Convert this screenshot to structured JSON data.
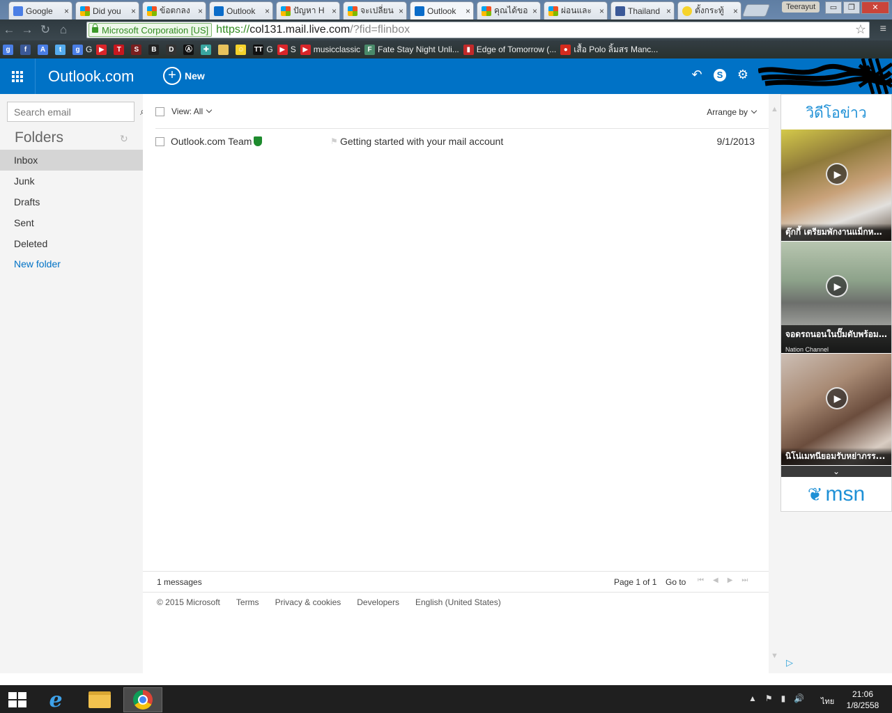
{
  "browser": {
    "tabs": [
      {
        "title": "Google",
        "favicon": "google-translate-icon"
      },
      {
        "title": "Did you",
        "favicon": "microsoft-icon"
      },
      {
        "title": "ข้อตกลง",
        "favicon": "microsoft-icon"
      },
      {
        "title": "Outlook",
        "favicon": "outlook-icon"
      },
      {
        "title": "ปัญหา H",
        "favicon": "microsoft-icon"
      },
      {
        "title": "จะเปลี่ยน",
        "favicon": "microsoft-icon"
      },
      {
        "title": "Outlook",
        "favicon": "outlook-icon"
      },
      {
        "title": "คุณได้ขอ",
        "favicon": "microsoft-icon"
      },
      {
        "title": "ผ่อนและ",
        "favicon": "microsoft-icon"
      },
      {
        "title": "Thailand",
        "favicon": "facebook-icon"
      },
      {
        "title": "ตั้งกระทู้",
        "favicon": "smiley-icon"
      }
    ],
    "tab_close": "×",
    "profile_name": "Teerayut",
    "window_buttons": {
      "minimize": "▭",
      "maximize": "❐",
      "close": "✕"
    },
    "nav": {
      "back": "←",
      "forward": "→",
      "reload": "↻",
      "home": "⌂"
    },
    "ev_cert": "Microsoft Corporation [US]",
    "url_scheme": "https://",
    "url_host": "col131.mail.live.com",
    "url_path": "/?fid=flinbox",
    "bookmark_star": "☆",
    "menu_icon": "≡",
    "bookmarks": [
      {
        "label": "",
        "icon": "google-plus-icon",
        "color": "#4a7ee5",
        "glyph": "g"
      },
      {
        "label": "",
        "icon": "facebook-icon",
        "color": "#3b5998",
        "glyph": "f"
      },
      {
        "label": "",
        "icon": "translate-icon",
        "color": "#4a7ee5",
        "glyph": "A"
      },
      {
        "label": "",
        "icon": "twitter-icon",
        "color": "#55acee",
        "glyph": "t"
      },
      {
        "label": "G",
        "icon": "google-icon",
        "color": "#4a7ee5",
        "glyph": "g"
      },
      {
        "label": "",
        "icon": "youtube-icon",
        "color": "#d9252a",
        "glyph": "▶"
      },
      {
        "label": "",
        "icon": "tc-icon",
        "color": "#c7171e",
        "glyph": "T"
      },
      {
        "label": "",
        "icon": "anime-icon",
        "color": "#7a1f1f",
        "glyph": "S"
      },
      {
        "label": "",
        "icon": "bookmark-b-icon",
        "color": "#222222",
        "glyph": "B"
      },
      {
        "label": "",
        "icon": "bookmark-d-icon",
        "color": "#333333",
        "glyph": "D"
      },
      {
        "label": "",
        "icon": "anarchy-icon",
        "color": "#111111",
        "glyph": "Ⓐ"
      },
      {
        "label": "",
        "icon": "puzzle-icon",
        "color": "#3aa6a0",
        "glyph": "✚"
      },
      {
        "label": "",
        "icon": "folder-icon",
        "color": "#e8c25c",
        "glyph": ""
      },
      {
        "label": "",
        "icon": "smiley-icon",
        "color": "#f6d32b",
        "glyph": "☺"
      },
      {
        "label": "G",
        "icon": "tt-icon",
        "color": "#111111",
        "glyph": "TT"
      },
      {
        "label": "S",
        "icon": "youtube-icon",
        "color": "#d9252a",
        "glyph": "▶"
      },
      {
        "label": "musicclassic",
        "icon": "youtube-icon",
        "color": "#d9252a",
        "glyph": "▶"
      },
      {
        "label": "Fate Stay Night Unli...",
        "icon": "fate-icon",
        "color": "#4a8a6a",
        "glyph": "F"
      },
      {
        "label": "Edge of Tomorrow (...",
        "icon": "popcorn-icon",
        "color": "#c22a2a",
        "glyph": "▮"
      },
      {
        "label": "เสื้อ Polo ลิ้มสร Manc...",
        "icon": "club-crest-icon",
        "color": "#d52b1e",
        "glyph": "●"
      }
    ]
  },
  "outlook": {
    "brand": "Outlook.com",
    "new_label": "New",
    "new_plus": "+",
    "header_icons": {
      "undo": "↶",
      "skype": "S",
      "settings": "⚙"
    },
    "search_placeholder": "Search email",
    "search_icon_glyph": "⌕",
    "folders_title": "Folders",
    "refresh_glyph": "↻",
    "folders": [
      "Inbox",
      "Junk",
      "Drafts",
      "Sent",
      "Deleted"
    ],
    "selected_folder": "Inbox",
    "new_folder": "New folder",
    "view_label": "View: All",
    "arrange_label": "Arrange by",
    "messages": [
      {
        "sender": "Outlook.com Team",
        "verified": true,
        "subject": "Getting started with your mail account",
        "date": "9/1/2013"
      }
    ],
    "flag_glyph": "⚑",
    "message_count": "1 messages",
    "page_info": "Page 1 of 1",
    "goto_label": "Go to",
    "page_nav": {
      "first": "⏮",
      "prev": "◀",
      "next": "▶",
      "last": "⏭"
    },
    "footer": [
      "© 2015 Microsoft",
      "Terms",
      "Privacy & cookies",
      "Developers",
      "English (United States)"
    ]
  },
  "rail": {
    "title": "วิดีโอข่าว",
    "play_glyph": "▶",
    "videos": [
      {
        "caption": "ตุ๊กกี้ เตรียมพักงานแม็กหม..."
      },
      {
        "caption": "จอดรถนอนในปั๊มดับพร้อม...",
        "source": "Nation Channel"
      },
      {
        "caption": "นิโน่เมทนียอมรับหย่าภรร..."
      }
    ],
    "more_glyph": "⌄",
    "msn_label": "msn",
    "msn_glyph": "❦",
    "scroll_up": "▲",
    "scroll_down": "▼",
    "adchoices_glyph": "▷"
  },
  "taskbar": {
    "tray_glyphs": [
      "▲",
      "⚑",
      "▮",
      "🔊"
    ],
    "language": "ไทย",
    "time": "21:06",
    "date": "1/8/2558"
  },
  "colors": {
    "outlook_blue": "#0072c6",
    "inbox_selected": "#d5d5d5",
    "link_blue": "#0072c6",
    "shield_green": "#1e8b2e"
  }
}
